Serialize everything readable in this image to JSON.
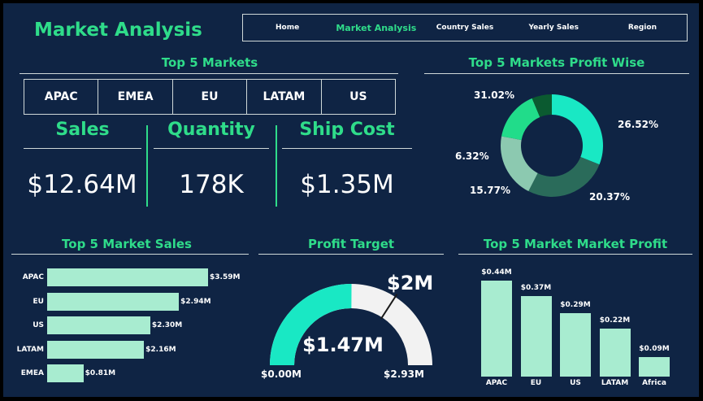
{
  "header": {
    "title": "Market Analysis"
  },
  "nav": {
    "items": [
      "Home",
      "Market Analysis",
      "Country Sales",
      "Yearly Sales",
      "Region"
    ],
    "active": "Market Analysis"
  },
  "top_markets": {
    "title": "Top 5 Markets",
    "items": [
      "APAC",
      "EMEA",
      "EU",
      "LATAM",
      "US"
    ]
  },
  "kpis": [
    {
      "label": "Sales",
      "value": "$12.64M"
    },
    {
      "label": "Quantity",
      "value": "178K"
    },
    {
      "label": "Ship Cost",
      "value": "$1.35M"
    }
  ],
  "colors": {
    "background": "#0f2444",
    "accent": "#2fdc8a",
    "bar": "#a8ecd0",
    "gauge_fill": "#19e8c4",
    "gauge_track": "#f2f2f2"
  },
  "chart_data": [
    {
      "type": "pie",
      "title": "Top 5 Markets Profit Wise",
      "slices": [
        {
          "label": "31.02%",
          "value": 31.02,
          "color": "#19e8c4"
        },
        {
          "label": "26.52%",
          "value": 26.52,
          "color": "#2a6b5a"
        },
        {
          "label": "20.37%",
          "value": 20.37,
          "color": "#8cc9b0"
        },
        {
          "label": "15.77%",
          "value": 15.77,
          "color": "#21dc8a"
        },
        {
          "label": "6.32%",
          "value": 6.32,
          "color": "#0b5a30"
        }
      ]
    },
    {
      "type": "bar",
      "orientation": "horizontal",
      "title": "Top 5 Market Sales",
      "categories": [
        "APAC",
        "EU",
        "US",
        "LATAM",
        "EMEA"
      ],
      "values": [
        3.59,
        2.94,
        2.3,
        2.16,
        0.81
      ],
      "labels": [
        "$3.59M",
        "$2.94M",
        "$2.30M",
        "$2.16M",
        "$0.81M"
      ]
    },
    {
      "type": "gauge",
      "title": "Profit Target",
      "value": 1.47,
      "min": 0,
      "max": 2.93,
      "target": 2,
      "value_label": "$1.47M",
      "min_label": "$0.00M",
      "max_label": "$2.93M",
      "target_label": "$2M"
    },
    {
      "type": "bar",
      "orientation": "vertical",
      "title": "Top 5 Market Market Profit",
      "categories": [
        "APAC",
        "EU",
        "US",
        "LATAM",
        "Africa"
      ],
      "values": [
        0.44,
        0.37,
        0.29,
        0.22,
        0.09
      ],
      "labels": [
        "$0.44M",
        "$0.37M",
        "$0.29M",
        "$0.22M",
        "$0.09M"
      ]
    }
  ]
}
